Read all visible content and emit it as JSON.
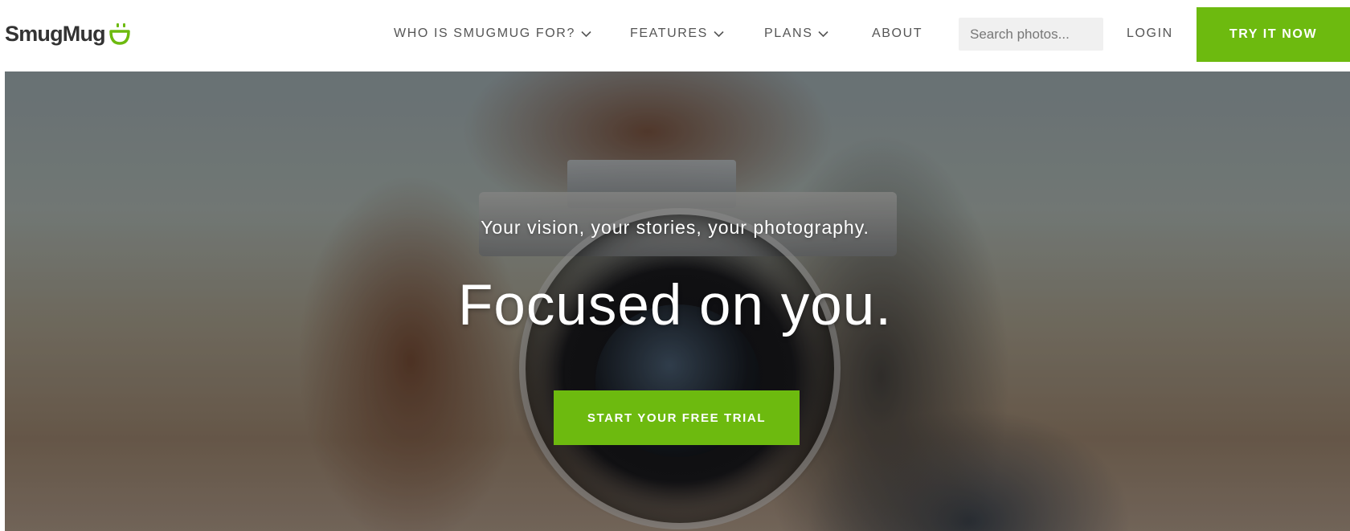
{
  "header": {
    "logo_text": "SmugMug",
    "nav": [
      {
        "label": "WHO IS SMUGMUG FOR?",
        "has_dropdown": true
      },
      {
        "label": "FEATURES",
        "has_dropdown": true
      },
      {
        "label": "PLANS",
        "has_dropdown": true
      },
      {
        "label": "ABOUT",
        "has_dropdown": false
      }
    ],
    "search_placeholder": "Search photos...",
    "login_label": "LOGIN",
    "try_label": "TRY IT NOW"
  },
  "hero": {
    "tagline": "Your vision, your stories, your photography.",
    "headline": "Focused on you.",
    "cta_label": "START YOUR FREE TRIAL"
  },
  "colors": {
    "accent_green": "#6dba0f",
    "nav_text": "#555555",
    "logo_text": "#333333"
  },
  "icons": {
    "logo_mark": "smugmug-smile-icon",
    "dropdown": "chevron-down-icon"
  }
}
